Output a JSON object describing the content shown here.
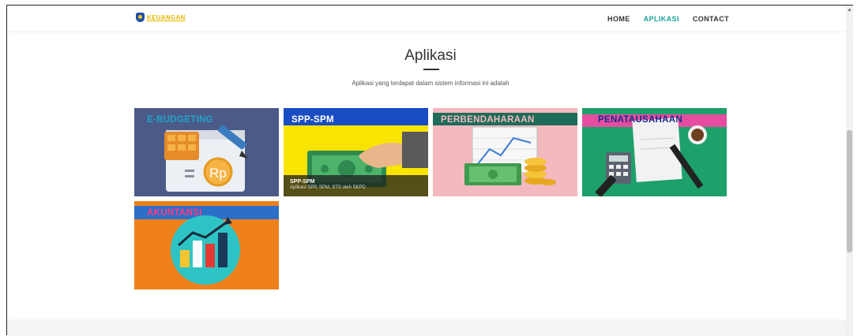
{
  "navbar": {
    "logo_text": "KEUANGAN",
    "items": [
      {
        "label": "HOME",
        "active": false
      },
      {
        "label": "APLIKASI",
        "active": true
      },
      {
        "label": "CONTACT",
        "active": false
      }
    ]
  },
  "section": {
    "title": "Aplikasi",
    "subtitle": "Aplikasi yang terdapat dalam sistem informasi ini adalah"
  },
  "cards": [
    {
      "label": "E-BUDGETING"
    },
    {
      "label": "SPP-SPM",
      "caption_title": "SPP-SPM",
      "caption_text": "Aplikasi SPP, SPM, STS oleh SKPD"
    },
    {
      "label": "PERBENDAHARAAN"
    },
    {
      "label": "PENATAUSAHAAN"
    },
    {
      "label": "AKUNTANSI"
    }
  ],
  "colors": {
    "accent": "#1aa59a",
    "logo": "#e5b800"
  }
}
